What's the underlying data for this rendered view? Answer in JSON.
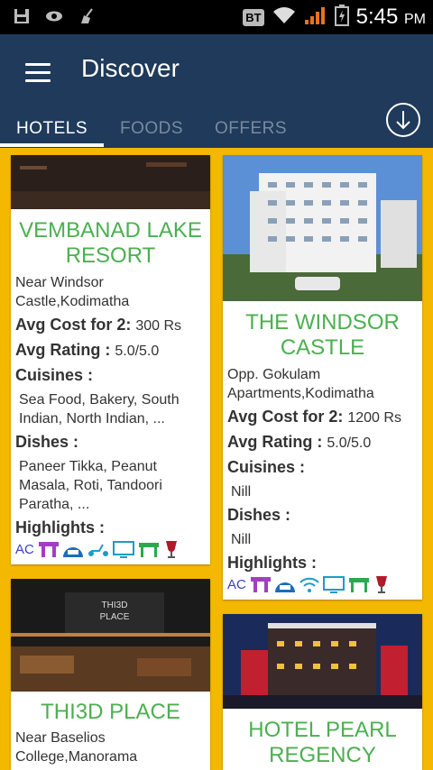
{
  "status_bar": {
    "carrier_badge": "BT",
    "time": "5:45",
    "ampm": "PM"
  },
  "app_bar": {
    "title": "Discover"
  },
  "tabs": [
    {
      "label": "HOTELS"
    },
    {
      "label": "FOODS"
    },
    {
      "label": "OFFERS"
    }
  ],
  "cards": [
    {
      "name_line1": "VEMBANAD LAKE",
      "name_line2": "RESORT",
      "address_line1": "Near Windsor",
      "address_line2": "Castle,Kodimatha",
      "avg_cost_label": "Avg Cost for 2:",
      "avg_cost_value": "300 Rs",
      "avg_rating_label": "Avg Rating :",
      "avg_rating_value": "5.0/5.0",
      "cuisines_label": "Cuisines :",
      "cuisines_line1": "Sea Food, Bakery, South",
      "cuisines_line2": "Indian, North Indian, ...",
      "dishes_label": "Dishes :",
      "dishes_line1": "Paneer Tikka, Peanut",
      "dishes_line2": "Masala, Roti, Tandoori",
      "dishes_line3": "Paratha, ...",
      "highlights_label": "Highlights :",
      "ac_label": "AC"
    },
    {
      "name_line1": "THE WINDSOR",
      "name_line2": "CASTLE",
      "address_line1": "Opp. Gokulam",
      "address_line2": "Apartments,Kodimatha",
      "avg_cost_label": "Avg Cost for 2:",
      "avg_cost_value": "1200 Rs",
      "avg_rating_label": "Avg Rating :",
      "avg_rating_value": "5.0/5.0",
      "cuisines_label": "Cuisines :",
      "cuisines_line1": "Nill",
      "dishes_label": "Dishes :",
      "dishes_line1": "Nill",
      "highlights_label": "Highlights :",
      "ac_label": "AC"
    },
    {
      "name_line1": "THI3D PLACE",
      "address_line1": "Near Baselios",
      "address_line2": "College,Manorama"
    },
    {
      "name_line1": "HOTEL PEARL",
      "name_line2": "REGENCY"
    }
  ],
  "colors": {
    "app_bar": "#1f3a5a",
    "background": "#f5b800",
    "hotel_name": "#4caf50",
    "amenity_icon": "#a040c0"
  }
}
